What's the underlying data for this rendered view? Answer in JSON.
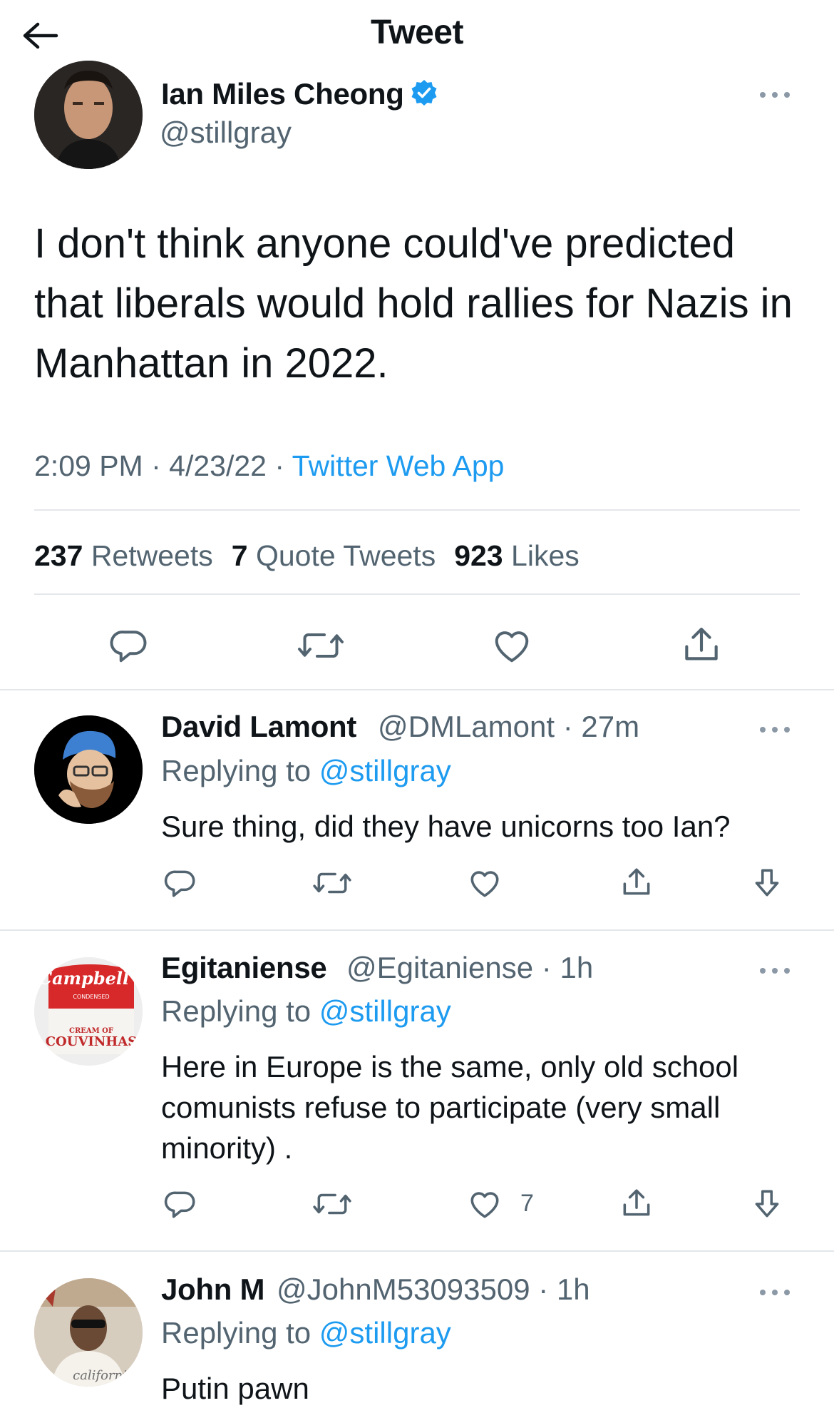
{
  "header": {
    "title": "Tweet"
  },
  "main_tweet": {
    "author_name": "Ian Miles Cheong",
    "author_handle": "@stillgray",
    "text": "I don't think anyone could've predicted that liberals would hold rallies for Nazis in Manhattan in 2022.",
    "time": "2:09 PM",
    "date": "4/23/22",
    "source": "Twitter Web App",
    "retweets_count": "237",
    "retweets_label": "Retweets",
    "quotes_count": "7",
    "quotes_label": "Quote Tweets",
    "likes_count": "923",
    "likes_label": "Likes"
  },
  "replies": [
    {
      "name": "David Lamont",
      "handle": "@DMLamont",
      "time": "27m",
      "replying_label": "Replying to",
      "replying_to": "@stillgray",
      "text": "Sure thing, did they have unicorns too Ian?",
      "like_count": ""
    },
    {
      "name": "Egitaniense",
      "handle": "@Egitaniense",
      "time": "1h",
      "replying_label": "Replying to",
      "replying_to": "@stillgray",
      "text": "Here in Europe is the same, only old school comunists refuse to participate (very small minority) .",
      "like_count": "7",
      "avatar_text": {
        "top": "Campbell's",
        "mid": "CONDENSED",
        "cream": "CREAM OF",
        "bottom": "COUVINHAS"
      }
    },
    {
      "name": "John M",
      "handle": "@JohnM53093509",
      "time": "1h",
      "replying_label": "Replying to",
      "replying_to": "@stillgray",
      "text": "Putin pawn",
      "avatar_text": "californi"
    }
  ],
  "colors": {
    "accent": "#1d9bf0",
    "secondary_text": "#536471",
    "divider": "#e4e7ea"
  }
}
